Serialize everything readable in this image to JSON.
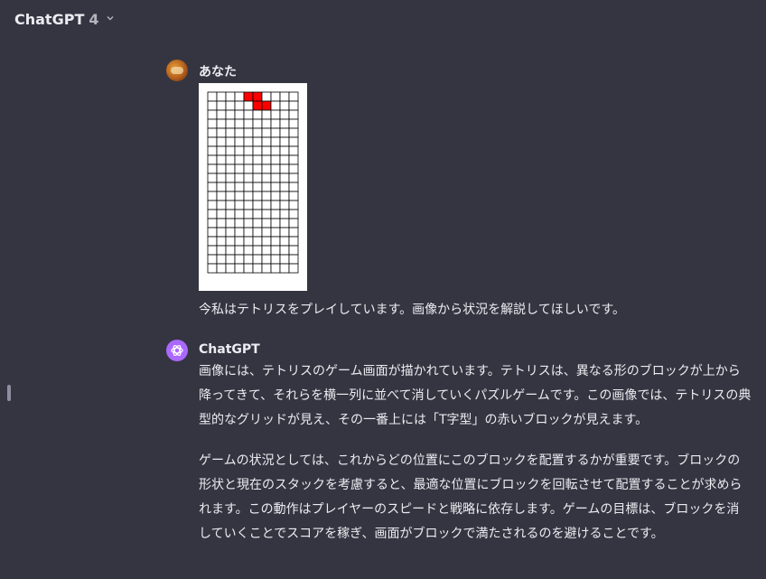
{
  "header": {
    "app_name": "ChatGPT",
    "model": "4"
  },
  "user_message": {
    "author": "あなた",
    "text": "今私はテトリスをプレイしています。画像から状況を解説してほしいです。",
    "image": {
      "grid_cols": 10,
      "grid_rows": 20,
      "piece_color": "#ff0000",
      "red_cells": [
        [
          0,
          4
        ],
        [
          0,
          5
        ],
        [
          1,
          5
        ],
        [
          1,
          6
        ]
      ]
    }
  },
  "assistant_message": {
    "author": "ChatGPT",
    "paragraphs": [
      "画像には、テトリスのゲーム画面が描かれています。テトリスは、異なる形のブロックが上から降ってきて、それらを横一列に並べて消していくパズルゲームです。この画像では、テトリスの典型的なグリッドが見え、その一番上には「T字型」の赤いブロックが見えます。",
      "ゲームの状況としては、これからどの位置にこのブロックを配置するかが重要です。ブロックの形状と現在のスタックを考慮すると、最適な位置にブロックを回転させて配置することが求められます。この動作はプレイヤーのスピードと戦略に依存します。ゲームの目標は、ブロックを消していくことでスコアを稼ぎ、画面がブロックで満たされるのを避けることです。"
    ]
  },
  "colors": {
    "background": "#343541",
    "text": "#ececf1",
    "assistant_avatar": "#ab68ff"
  },
  "icons": {
    "model_dropdown": "chevron-down-icon",
    "assistant_avatar": "openai-logo-icon"
  }
}
